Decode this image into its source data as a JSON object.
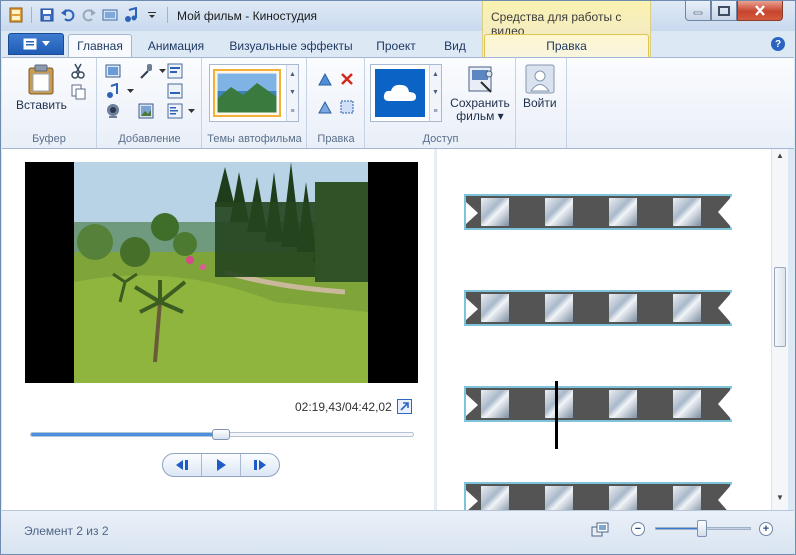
{
  "window": {
    "title": "Мой фильм - Киностудия",
    "context_tab_header": "Средства для работы с видео",
    "context_tab_label": "Правка"
  },
  "tabs": [
    {
      "label": "Главная",
      "active": true
    },
    {
      "label": "Анимация"
    },
    {
      "label": "Визуальные эффекты"
    },
    {
      "label": "Проект"
    },
    {
      "label": "Вид"
    }
  ],
  "ribbon": {
    "clipboard": {
      "paste_label": "Вставить",
      "group_label": "Буфер"
    },
    "add": {
      "group_label": "Добавление"
    },
    "themes": {
      "group_label": "Темы автофильма"
    },
    "edit": {
      "group_label": "Правка"
    },
    "share": {
      "save_label_1": "Сохранить",
      "save_label_2": "фильм ▾",
      "group_label": "Доступ"
    },
    "signin": {
      "label": "Войти"
    }
  },
  "preview": {
    "timecode": "02:19,43/04:42,02",
    "progress": 0.5
  },
  "status": {
    "text": "Элемент 2 из 2",
    "zoom": 0.5
  },
  "colors": {
    "accent": "#2a64c0",
    "clip_border": "#7fc3da",
    "context_tab": "#f3ebc1"
  }
}
